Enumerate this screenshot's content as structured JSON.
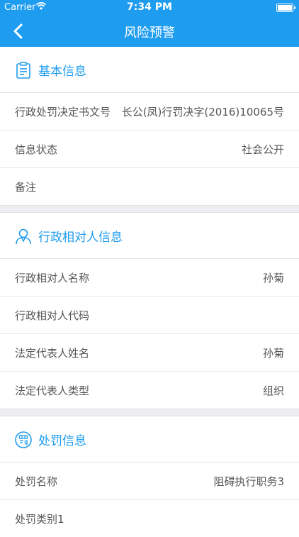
{
  "status_bar": {
    "carrier": "Carrier",
    "time": "7:34 PM"
  },
  "nav": {
    "title": "风险预警"
  },
  "sections": [
    {
      "title": "基本信息",
      "icon": "clipboard-icon",
      "rows": [
        {
          "label": "行政处罚决定书文号",
          "value": "长公(凤)行罚决字(2016)10065号"
        },
        {
          "label": "信息状态",
          "value": "社会公开"
        },
        {
          "label": "备注",
          "value": ""
        }
      ]
    },
    {
      "title": "行政相对人信息",
      "icon": "person-icon",
      "rows": [
        {
          "label": "行政相对人名称",
          "value": "孙菊"
        },
        {
          "label": "行政相对人代码",
          "value": ""
        },
        {
          "label": "法定代表人姓名",
          "value": "孙菊"
        },
        {
          "label": "法定代表人类型",
          "value": "组织"
        }
      ]
    },
    {
      "title": "处罚信息",
      "icon": "penalty-icon",
      "rows": [
        {
          "label": "处罚名称",
          "value": "阻碍执行职务3"
        },
        {
          "label": "处罚类别1",
          "value": ""
        }
      ]
    }
  ],
  "colors": {
    "accent": "#1e9cf0",
    "separator": "#eeeef2"
  }
}
